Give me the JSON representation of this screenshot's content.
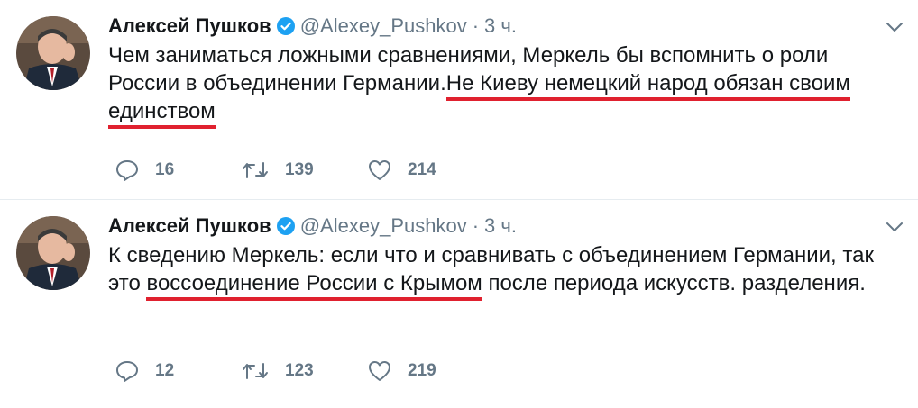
{
  "tweets": [
    {
      "author_name": "Алексей Пушков",
      "handle": "@Alexey_Pushkov",
      "separator": "·",
      "time": "3 ч.",
      "text_plain": "Чем заниматься ложными сравнениями, Меркель бы вспомнить о роли России в объединении Германии.",
      "text_highlighted": "Не Киеву немецкий народ обязан своим единством",
      "text_after": "",
      "replies": "16",
      "retweets": "139",
      "likes": "214"
    },
    {
      "author_name": "Алексей Пушков",
      "handle": "@Alexey_Pushkov",
      "separator": "·",
      "time": "3 ч.",
      "text_plain": "К сведению Меркель: если что и сравнивать с объединением Германии, так это ",
      "text_highlighted": "воссоединение России с Крымом",
      "text_after": " после периода искусств. разделения.",
      "replies": "12",
      "retweets": "123",
      "likes": "219"
    }
  ],
  "colors": {
    "verified": "#1da1f2",
    "underline": "#e0212f",
    "meta": "#657786"
  }
}
